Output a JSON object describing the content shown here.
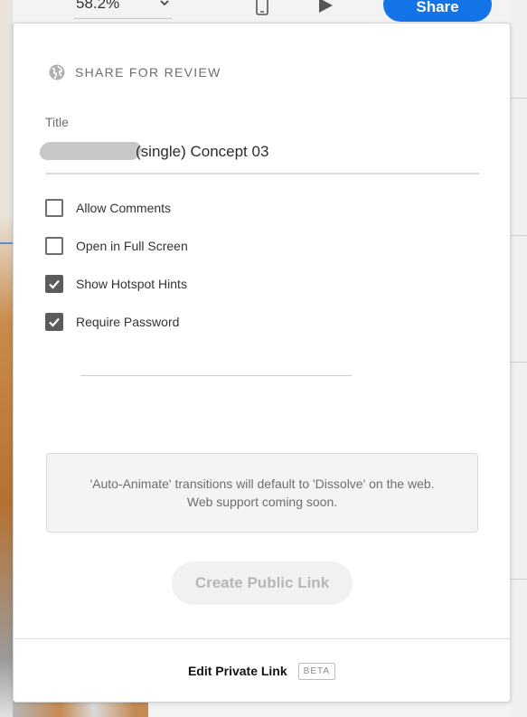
{
  "toolbar": {
    "zoom_value": "58.2%",
    "share_label": "Share",
    "icons": {
      "zoom_dropdown": "chevron-down-icon",
      "device": "phone-icon",
      "preview": "play-icon"
    }
  },
  "share_panel": {
    "header_icon": "globe-icon",
    "header_title": "SHARE FOR REVIEW",
    "title_label": "Title",
    "title_value": "(single) Concept 03",
    "options": [
      {
        "label": "Allow Comments",
        "checked": false
      },
      {
        "label": "Open in Full Screen",
        "checked": false
      },
      {
        "label": "Show Hotspot Hints",
        "checked": true
      },
      {
        "label": "Require Password",
        "checked": true
      }
    ],
    "password_value": "",
    "notice": "'Auto-Animate' transitions will default to 'Dissolve' on the web. Web support coming soon.",
    "create_button": "Create Public Link",
    "footer_link": "Edit Private Link",
    "footer_badge": "BETA"
  },
  "colors": {
    "accent": "#1473e6",
    "checkbox_checked": "#5c5c5c",
    "disabled_text": "#b7b7b7"
  }
}
